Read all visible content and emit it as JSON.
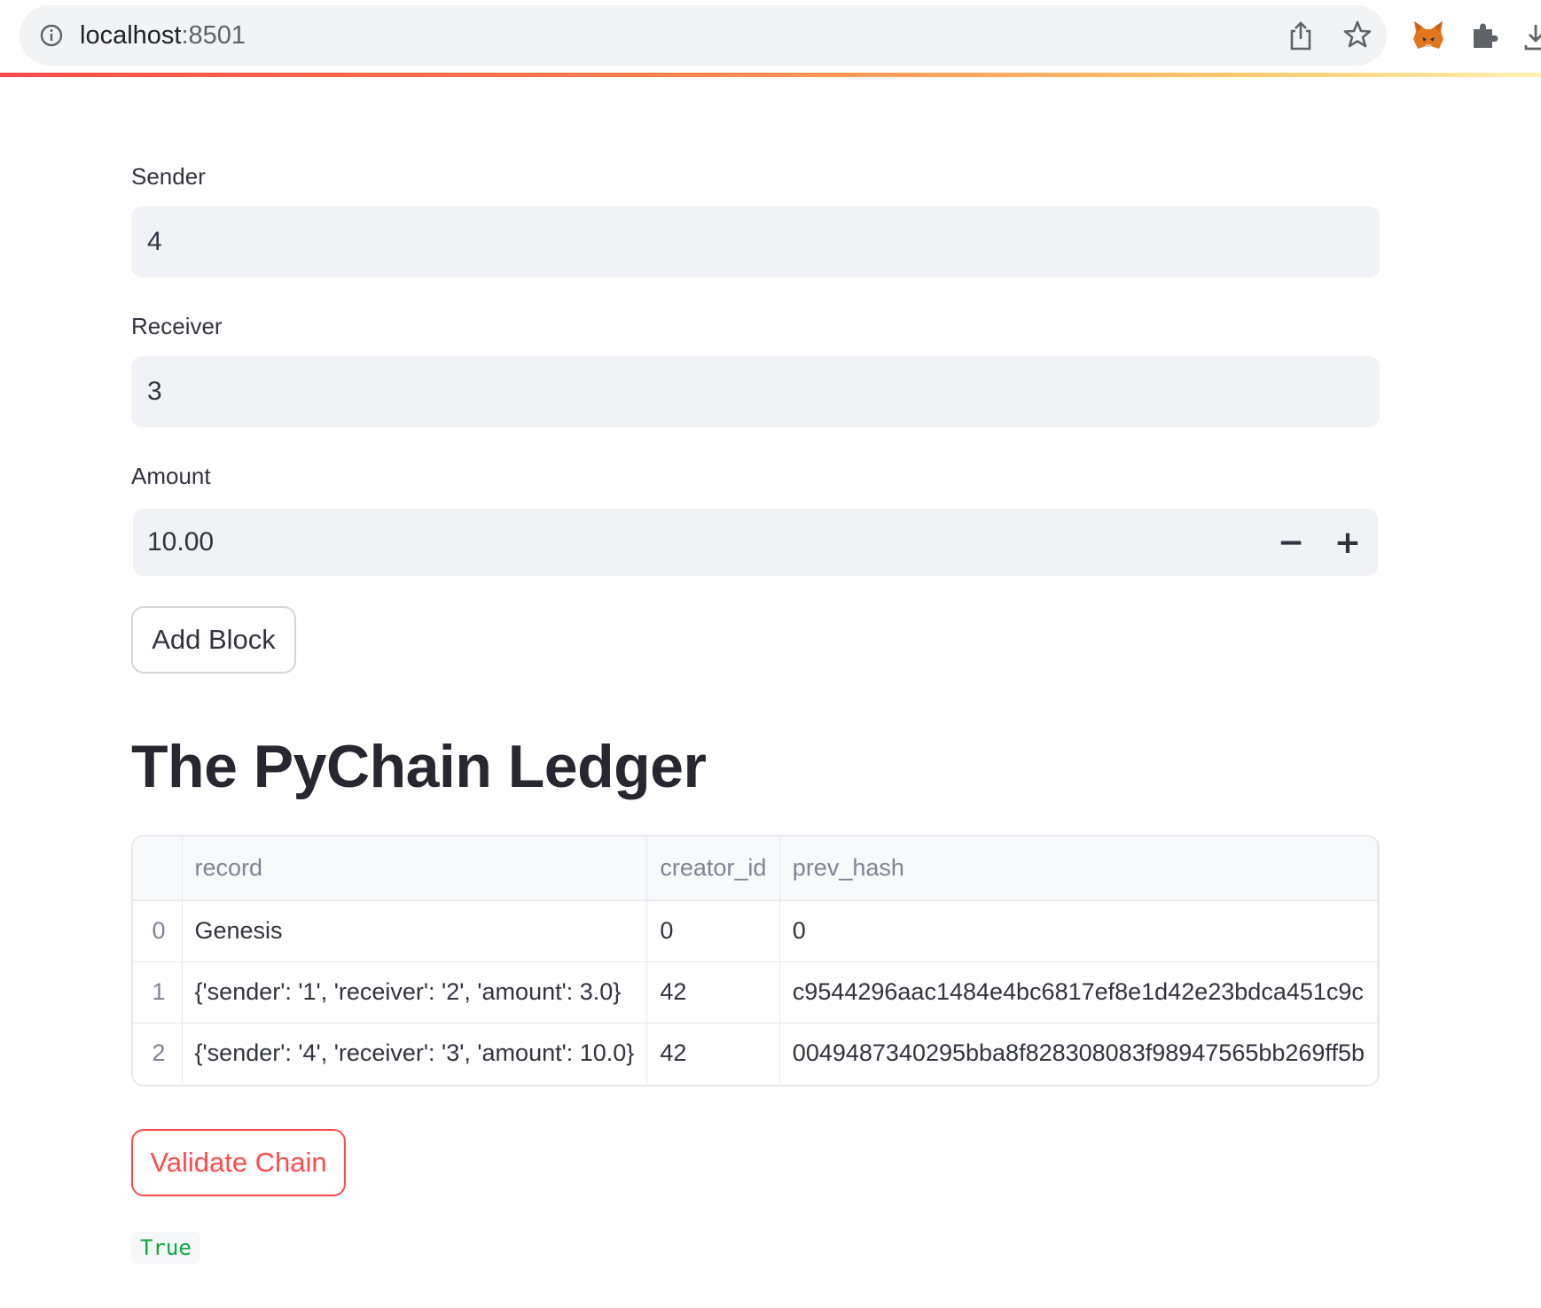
{
  "browser": {
    "url_host": "localhost",
    "url_port": ":8501",
    "icons": [
      "info-icon",
      "share-icon",
      "star-icon",
      "metamask-fox-icon",
      "extensions-puzzle-icon",
      "download-icon"
    ]
  },
  "form": {
    "sender_label": "Sender",
    "sender_value": "4",
    "receiver_label": "Receiver",
    "receiver_value": "3",
    "amount_label": "Amount",
    "amount_value": "10.00",
    "decrement_label": "−",
    "increment_label": "+",
    "add_block_label": "Add Block"
  },
  "ledger": {
    "title": "The PyChain Ledger",
    "columns": [
      "",
      "record",
      "creator_id",
      "prev_hash"
    ],
    "rows": [
      {
        "index": "0",
        "record": "Genesis",
        "creator_id": "0",
        "prev_hash": "0"
      },
      {
        "index": "1",
        "record": "{'sender': '1', 'receiver': '2', 'amount': 3.0}",
        "creator_id": "42",
        "prev_hash": "c9544296aac1484e4bc6817ef8e1d42e23bdca451c9c"
      },
      {
        "index": "2",
        "record": "{'sender': '4', 'receiver': '3', 'amount': 10.0}",
        "creator_id": "42",
        "prev_hash": "0049487340295bba8f828308083f98947565bb269ff5b"
      }
    ]
  },
  "validate": {
    "button_label": "Validate Chain",
    "result": "True"
  },
  "colors": {
    "accent": "#ff4b4b",
    "input_bg": "#f0f2f6",
    "success_text": "#09ab3b"
  }
}
